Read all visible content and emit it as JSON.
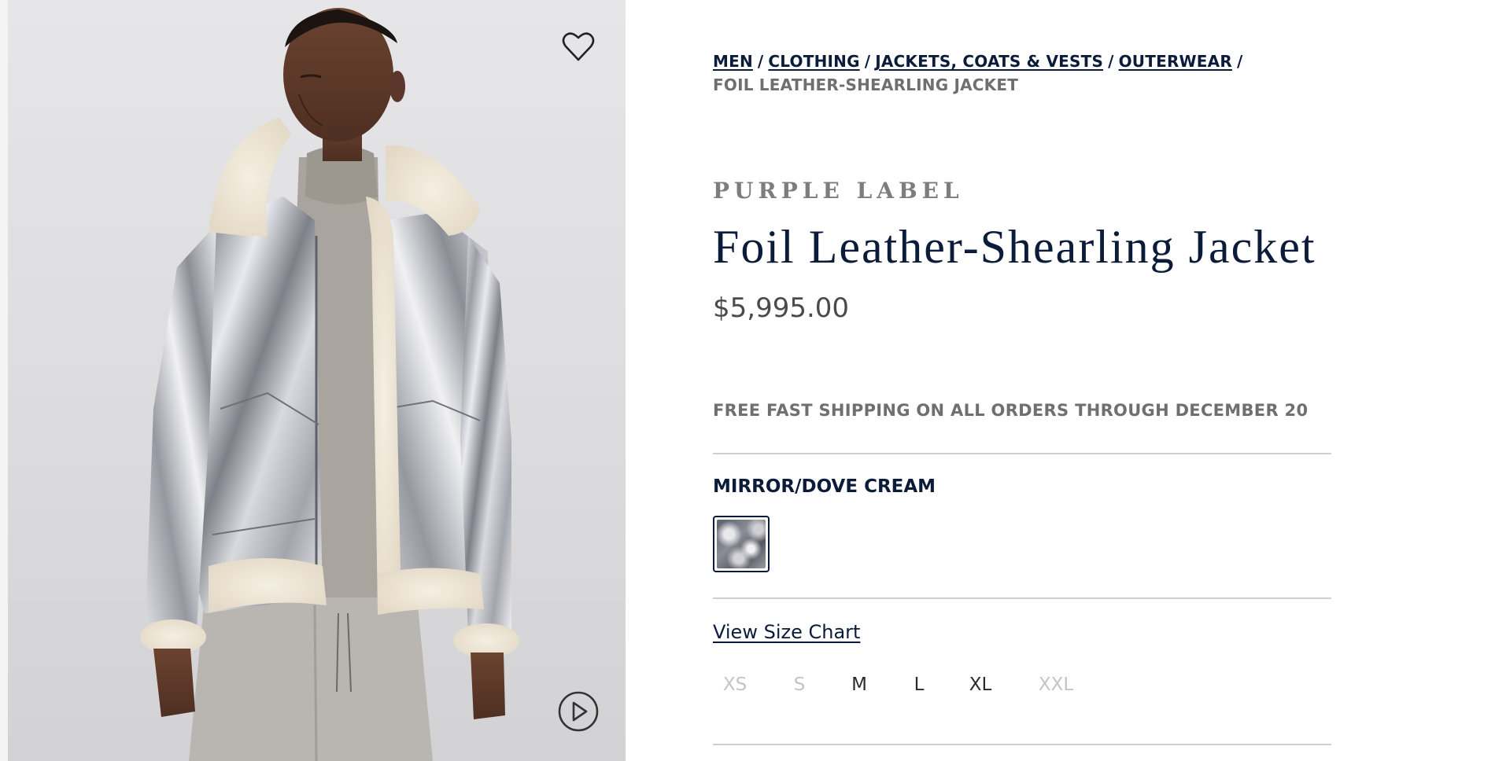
{
  "breadcrumb": {
    "items": [
      "MEN",
      "CLOTHING",
      "JACKETS, COATS & VESTS",
      "OUTERWEAR"
    ],
    "separator": "/",
    "current": "FOIL LEATHER-SHEARLING JACKET"
  },
  "product": {
    "brand": "PURPLE LABEL",
    "title": "Foil Leather-Shearling Jacket",
    "price": "$5,995.00",
    "shipping_note": "FREE FAST SHIPPING ON ALL ORDERS THROUGH DECEMBER 20",
    "color_name": "MIRROR/DOVE CREAM",
    "size_chart_label": "View Size Chart",
    "sizes": [
      {
        "label": "XS",
        "available": false
      },
      {
        "label": "S",
        "available": false
      },
      {
        "label": "M",
        "available": true
      },
      {
        "label": "L",
        "available": true
      },
      {
        "label": "XL",
        "available": true
      },
      {
        "label": "XXL",
        "available": false
      }
    ]
  },
  "icons": {
    "wishlist": "heart-outline-icon",
    "video": "play-circle-icon"
  },
  "colors": {
    "navy": "#0b1c3a",
    "gray_text": "#6f6f6f",
    "divider": "#cfcfcf",
    "disabled_size": "#c4c4c4"
  }
}
